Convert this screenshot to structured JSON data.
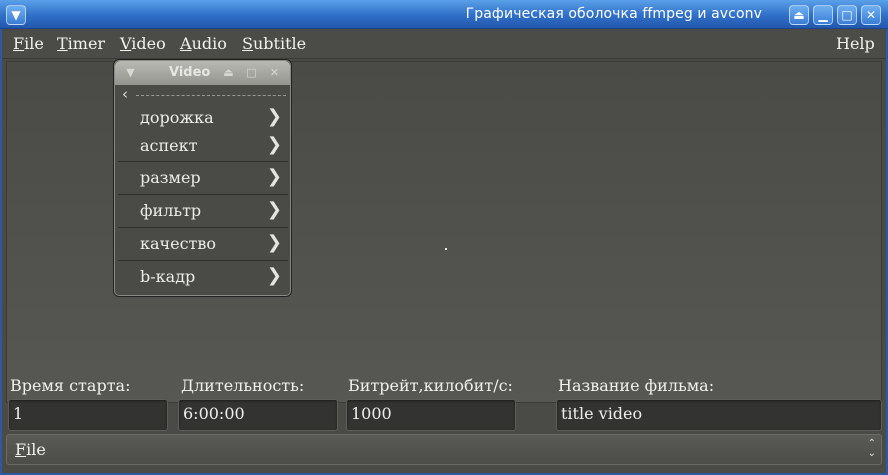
{
  "window": {
    "title": "Графическая оболочка ffmpeg и avconv"
  },
  "menubar": {
    "items": [
      {
        "label": "File",
        "mnemonic": "F",
        "rest": "ile"
      },
      {
        "label": "Timer",
        "mnemonic": "T",
        "rest": "imer"
      },
      {
        "label": "Video",
        "mnemonic": "V",
        "rest": "ideo"
      },
      {
        "label": "Audio",
        "mnemonic": "A",
        "rest": "udio"
      },
      {
        "label": "Subtitle",
        "mnemonic": "S",
        "rest": "ubtitle"
      }
    ],
    "help": "Help"
  },
  "video_menu": {
    "title": "Video",
    "items": [
      "дорожка",
      "аспект",
      "размер",
      "фильтр",
      "качество",
      "b-кадр"
    ]
  },
  "fields": {
    "start": {
      "label": "Время старта:",
      "value": "1"
    },
    "duration": {
      "label": "Длительность:",
      "value": "6:00:00"
    },
    "bitrate": {
      "label": "Битрейт,килобит/с:",
      "value": "1000"
    },
    "film_name": {
      "label": "Название фильма:",
      "value": "title video"
    }
  },
  "combo": {
    "value_mnemonic": "F",
    "value_rest": "ile"
  },
  "icons": {
    "window_menu": "chevron-down-circle-icon",
    "shade": "shade-icon",
    "minimize": "minimize-icon",
    "maximize": "maximize-icon",
    "close": "close-icon"
  },
  "colors": {
    "titlebar": "#2f6fc8",
    "background": "#4a4a46",
    "input": "#333331"
  }
}
